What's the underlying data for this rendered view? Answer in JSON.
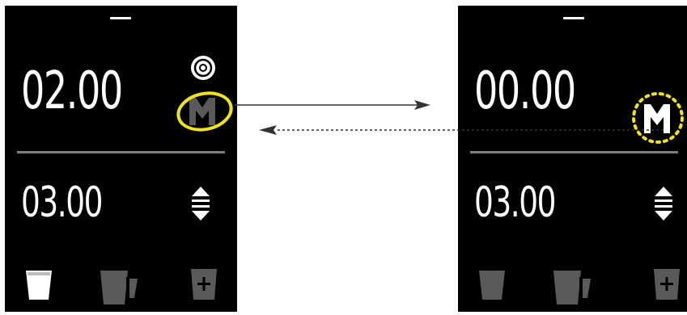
{
  "colors": {
    "screen_background": "#000000",
    "text": "#ffffff",
    "divider": "#7d7d7d",
    "inactive_icon": "#5a5a5a",
    "highlight": "#f2e21a",
    "arrow": "#333333"
  },
  "screens": [
    {
      "top_value": "02.00",
      "bottom_value": "03.00",
      "top_icons": [
        "target-icon",
        "m-memory-icon"
      ],
      "m_icon_state": "dimmed",
      "m_icon_highlight": "ellipse",
      "stepper_icon": "up-down-stepper-icon",
      "bottom_icons": [
        {
          "name": "single-cup-icon",
          "state": "active"
        },
        {
          "name": "double-cup-icon",
          "state": "inactive"
        },
        {
          "name": "add-cup-icon",
          "state": "inactive"
        }
      ]
    },
    {
      "top_value": "00.00",
      "bottom_value": "03.00",
      "top_icons": [
        "m-memory-icon"
      ],
      "m_icon_state": "active",
      "m_icon_highlight": "dotted-circle",
      "stepper_icon": "up-down-stepper-icon",
      "bottom_icons": [
        {
          "name": "single-cup-icon",
          "state": "inactive"
        },
        {
          "name": "double-cup-icon",
          "state": "inactive"
        },
        {
          "name": "add-cup-icon",
          "state": "inactive"
        }
      ]
    }
  ],
  "transitions": [
    {
      "name": "forward-arrow",
      "style": "solid",
      "direction": "right"
    },
    {
      "name": "return-arrow",
      "style": "dashed",
      "direction": "left"
    }
  ]
}
